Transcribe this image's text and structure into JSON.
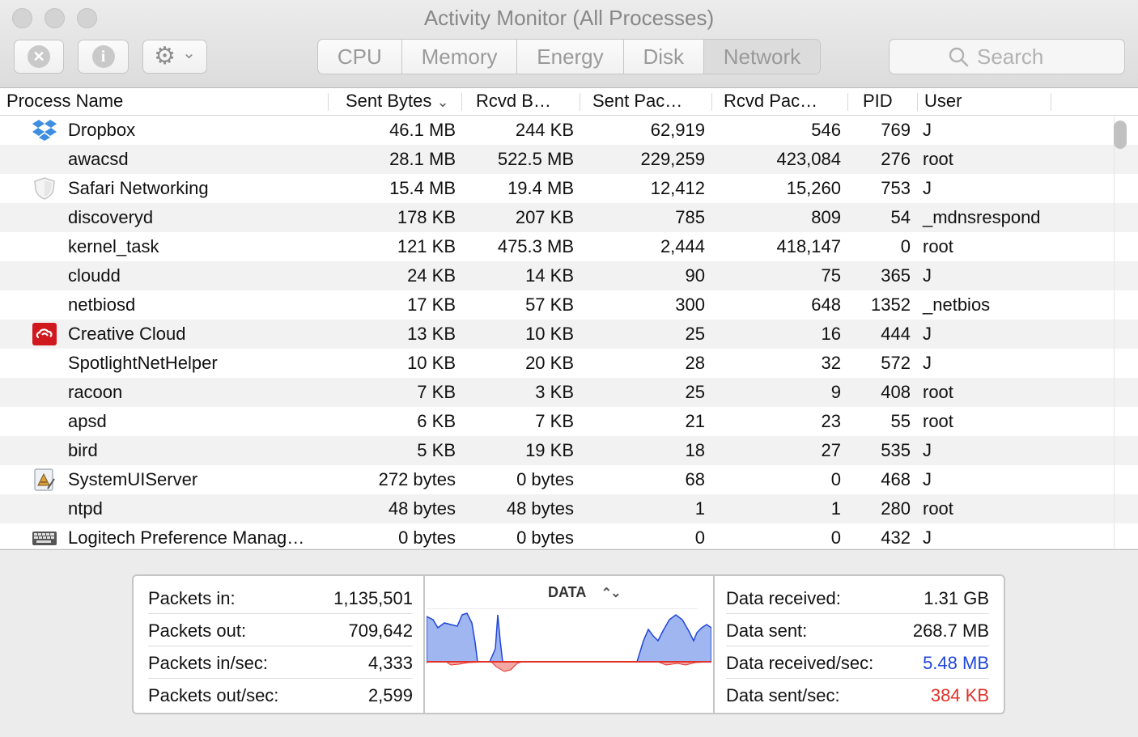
{
  "window": {
    "title": "Activity Monitor (All Processes)"
  },
  "toolbar": {
    "quit_icon_glyph": "✕",
    "info_icon_glyph": "i",
    "gear_icon_glyph": "⚙",
    "chevron_glyph": "⌄",
    "tabs": [
      {
        "label": "CPU",
        "active": false
      },
      {
        "label": "Memory",
        "active": false
      },
      {
        "label": "Energy",
        "active": false
      },
      {
        "label": "Disk",
        "active": false
      },
      {
        "label": "Network",
        "active": true
      }
    ],
    "search_placeholder": "Search"
  },
  "table": {
    "columns": {
      "name": "Process Name",
      "sent_bytes": "Sent Bytes",
      "rcvd_bytes": "Rcvd B…",
      "sent_packets": "Sent Pac…",
      "rcvd_packets": "Rcvd Pac…",
      "pid": "PID",
      "user": "User"
    },
    "sort_indicator": "⌄",
    "rows": [
      {
        "name": "Dropbox",
        "icon": "dropbox-icon",
        "sent_bytes": "46.1 MB",
        "rcvd_bytes": "244 KB",
        "sent_packets": "62,919",
        "rcvd_packets": "546",
        "pid": "769",
        "user": "J"
      },
      {
        "name": "awacsd",
        "icon": "",
        "sent_bytes": "28.1 MB",
        "rcvd_bytes": "522.5 MB",
        "sent_packets": "229,259",
        "rcvd_packets": "423,084",
        "pid": "276",
        "user": "root"
      },
      {
        "name": "Safari Networking",
        "icon": "shield-icon",
        "sent_bytes": "15.4 MB",
        "rcvd_bytes": "19.4 MB",
        "sent_packets": "12,412",
        "rcvd_packets": "15,260",
        "pid": "753",
        "user": "J"
      },
      {
        "name": "discoveryd",
        "icon": "",
        "sent_bytes": "178 KB",
        "rcvd_bytes": "207 KB",
        "sent_packets": "785",
        "rcvd_packets": "809",
        "pid": "54",
        "user": "_mdnsrespond"
      },
      {
        "name": "kernel_task",
        "icon": "",
        "sent_bytes": "121 KB",
        "rcvd_bytes": "475.3 MB",
        "sent_packets": "2,444",
        "rcvd_packets": "418,147",
        "pid": "0",
        "user": "root"
      },
      {
        "name": "cloudd",
        "icon": "",
        "sent_bytes": "24 KB",
        "rcvd_bytes": "14 KB",
        "sent_packets": "90",
        "rcvd_packets": "75",
        "pid": "365",
        "user": "J"
      },
      {
        "name": "netbiosd",
        "icon": "",
        "sent_bytes": "17 KB",
        "rcvd_bytes": "57 KB",
        "sent_packets": "300",
        "rcvd_packets": "648",
        "pid": "1352",
        "user": "_netbios"
      },
      {
        "name": "Creative Cloud",
        "icon": "creative-cloud-icon",
        "sent_bytes": "13 KB",
        "rcvd_bytes": "10 KB",
        "sent_packets": "25",
        "rcvd_packets": "16",
        "pid": "444",
        "user": "J"
      },
      {
        "name": "SpotlightNetHelper",
        "icon": "",
        "sent_bytes": "10 KB",
        "rcvd_bytes": "20 KB",
        "sent_packets": "28",
        "rcvd_packets": "32",
        "pid": "572",
        "user": "J"
      },
      {
        "name": "racoon",
        "icon": "",
        "sent_bytes": "7 KB",
        "rcvd_bytes": "3 KB",
        "sent_packets": "25",
        "rcvd_packets": "9",
        "pid": "408",
        "user": "root"
      },
      {
        "name": "apsd",
        "icon": "",
        "sent_bytes": "6 KB",
        "rcvd_bytes": "7 KB",
        "sent_packets": "21",
        "rcvd_packets": "23",
        "pid": "55",
        "user": "root"
      },
      {
        "name": "bird",
        "icon": "",
        "sent_bytes": "5 KB",
        "rcvd_bytes": "19 KB",
        "sent_packets": "18",
        "rcvd_packets": "27",
        "pid": "535",
        "user": "J"
      },
      {
        "name": "SystemUIServer",
        "icon": "system-ui-server-icon",
        "sent_bytes": "272 bytes",
        "rcvd_bytes": "0 bytes",
        "sent_packets": "68",
        "rcvd_packets": "0",
        "pid": "468",
        "user": "J"
      },
      {
        "name": "ntpd",
        "icon": "",
        "sent_bytes": "48 bytes",
        "rcvd_bytes": "48 bytes",
        "sent_packets": "1",
        "rcvd_packets": "1",
        "pid": "280",
        "user": "root"
      },
      {
        "name": "Logitech Preference Manag…",
        "icon": "keyboard-icon",
        "sent_bytes": "0 bytes",
        "rcvd_bytes": "0 bytes",
        "sent_packets": "0",
        "rcvd_packets": "0",
        "pid": "432",
        "user": "J"
      }
    ]
  },
  "summary": {
    "left": [
      {
        "label": "Packets in:",
        "value": "1,135,501"
      },
      {
        "label": "Packets out:",
        "value": "709,642"
      },
      {
        "label": "Packets in/sec:",
        "value": "4,333"
      },
      {
        "label": "Packets out/sec:",
        "value": "2,599"
      }
    ],
    "graph_title": "DATA",
    "graph_toggle_glyph": "⌃⌄",
    "right": [
      {
        "label": "Data received:",
        "value": "1.31 GB",
        "color": "#111111"
      },
      {
        "label": "Data sent:",
        "value": "268.7 MB",
        "color": "#111111"
      },
      {
        "label": "Data received/sec:",
        "value": "5.48 MB",
        "color": "#2046d8"
      },
      {
        "label": "Data sent/sec:",
        "value": "384 KB",
        "color": "#e0322a"
      }
    ],
    "colors": {
      "received": "#2046d8",
      "sent": "#e0322a"
    }
  }
}
